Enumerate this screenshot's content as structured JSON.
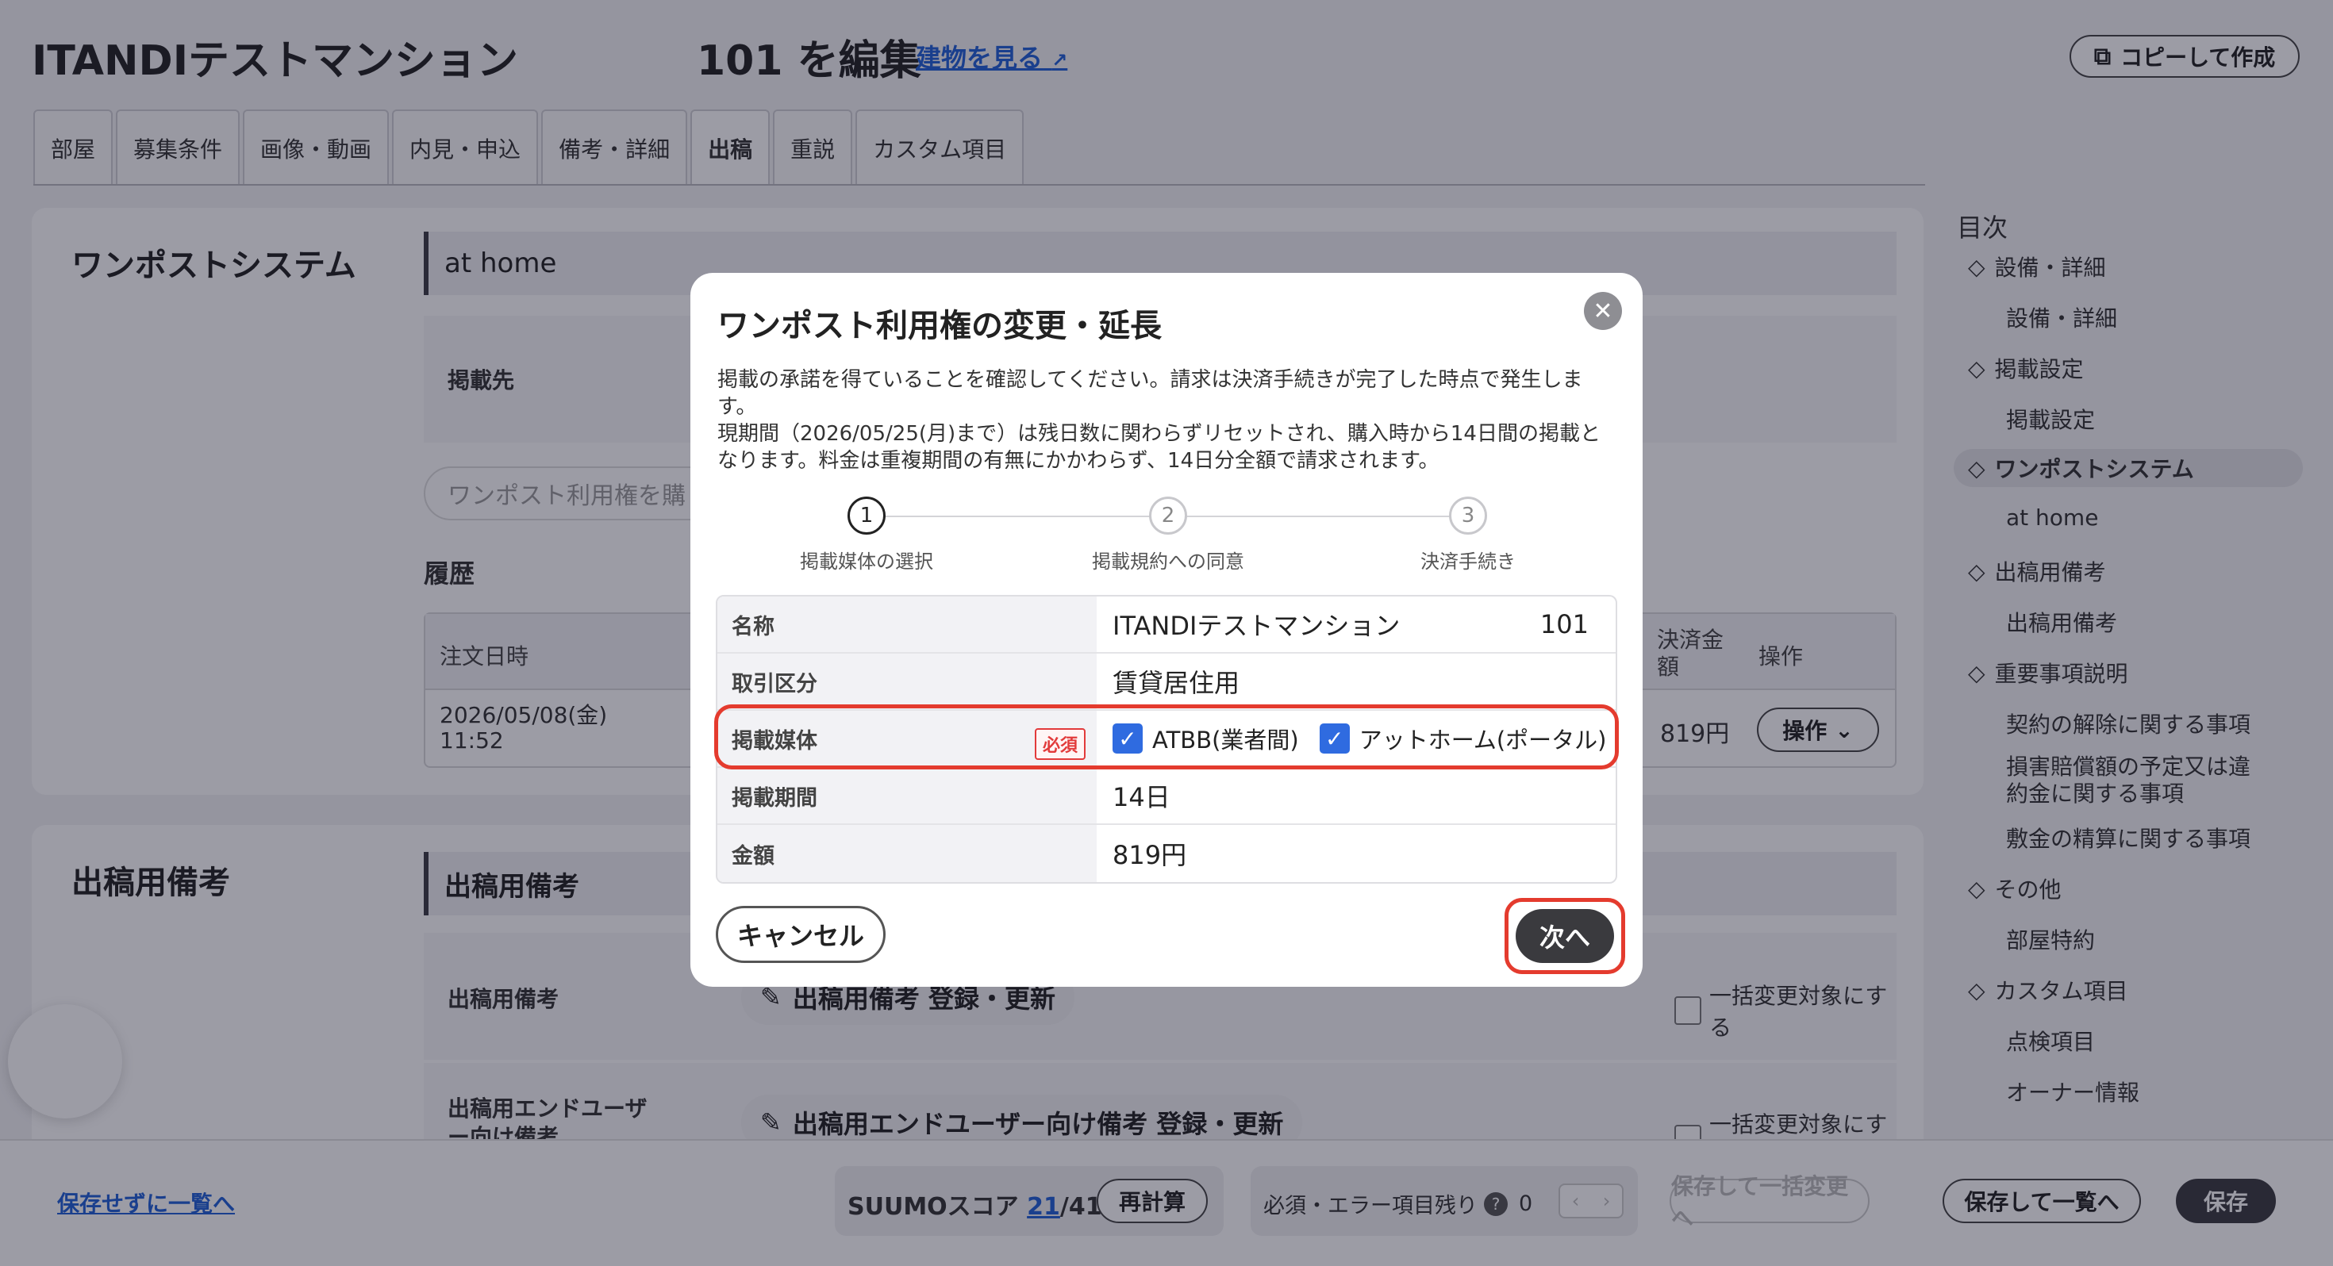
{
  "header": {
    "app_title": "ITANDIテストマンション",
    "edit_title": "101 を編集",
    "building_link": "建物を見る",
    "copy_button": "コピーして作成"
  },
  "tabs": [
    {
      "label": "部屋"
    },
    {
      "label": "募集条件"
    },
    {
      "label": "画像・動画"
    },
    {
      "label": "内見・申込"
    },
    {
      "label": "備考・詳細"
    },
    {
      "label": "出稿",
      "active": true
    },
    {
      "label": "重説"
    },
    {
      "label": "カスタム項目"
    }
  ],
  "onepost": {
    "section_title": "ワンポストシステム",
    "subhead": "at home",
    "destination_label": "掲載先",
    "right_button": "ワンポスト利用権を購",
    "history_label": "履歴",
    "table_headers": {
      "order_date": "注文日時",
      "amount": "決済金額",
      "operation": "操作"
    },
    "row": {
      "date": "2026/05/08(金)",
      "time": "11:52",
      "amount": "819円",
      "operation_button": "操作"
    }
  },
  "remarks": {
    "section_title": "出稿用備考",
    "subhead": "出稿用備考",
    "row1_label": "出稿用備考",
    "row1_button": "出稿用備考 登録・更新",
    "row2_label": "出稿用エンドユーザー向け備考",
    "row2_button": "出稿用エンドユーザー向け備考 登録・更新",
    "bulk_change": "一括変更対象にする"
  },
  "toc": {
    "title": "目次",
    "items": [
      {
        "label": "設備・詳細",
        "type": "group"
      },
      {
        "label": "設備・詳細",
        "type": "sub"
      },
      {
        "label": "掲載設定",
        "type": "group"
      },
      {
        "label": "掲載設定",
        "type": "sub"
      },
      {
        "label": "ワンポストシステム",
        "type": "group",
        "active": true
      },
      {
        "label": "at home",
        "type": "sub"
      },
      {
        "label": "出稿用備考",
        "type": "group"
      },
      {
        "label": "出稿用備考",
        "type": "sub"
      },
      {
        "label": "重要事項説明",
        "type": "group"
      },
      {
        "label": "契約の解除に関する事項",
        "type": "sub"
      },
      {
        "label": "損害賠償額の予定又は違約金に関する事項",
        "type": "sub"
      },
      {
        "label": "敷金の精算に関する事項",
        "type": "sub"
      },
      {
        "label": "その他",
        "type": "group"
      },
      {
        "label": "部屋特約",
        "type": "sub"
      },
      {
        "label": "カスタム項目",
        "type": "group"
      },
      {
        "label": "点検項目",
        "type": "sub"
      },
      {
        "label": "オーナー情報",
        "type": "sub"
      }
    ]
  },
  "bottombar": {
    "back_link": "保存せずに一覧へ",
    "suumo_label": "SUUMOスコア",
    "suumo_score": "21",
    "suumo_total": "/41",
    "recalc_button": "再計算",
    "remaining_label": "必須・エラー項目残り",
    "remaining_count": "0",
    "save_bulk_button": "保存して一括変更へ",
    "save_list_button": "保存して一覧へ",
    "save_button": "保存"
  },
  "modal": {
    "title": "ワンポスト利用権の変更・延長",
    "text_line1": "掲載の承諾を得ていることを確認してください。請求は決済手続きが完了した時点で発生します。",
    "text_line2": "現期間（2026/05/25(月)まで）は残日数に関わらずリセットされ、購入時から14日間の掲載となります。料金は重複期間の有無にかかわらず、14日分全額で請求されます。",
    "steps": [
      {
        "num": "1",
        "label": "掲載媒体の選択"
      },
      {
        "num": "2",
        "label": "掲載規約への同意"
      },
      {
        "num": "3",
        "label": "決済手続き"
      }
    ],
    "rows": {
      "name_label": "名称",
      "name_value": "ITANDIテストマンション",
      "name_room": "101",
      "deal_label": "取引区分",
      "deal_value": "賃貸居住用",
      "media_label": "掲載媒体",
      "required_badge": "必須",
      "media_option1": "ATBB(業者間)",
      "media_option2": "アットホーム(ポータル)",
      "period_label": "掲載期間",
      "period_value": "14日",
      "amount_label": "金額",
      "amount_value": "819円"
    },
    "cancel_button": "キャンセル",
    "next_button": "次へ"
  },
  "colors": {
    "accent_blue": "#2f6be0",
    "link_blue": "#1f5fd6",
    "highlight_red": "#e43b2e",
    "dark_button": "#3a3a3e"
  }
}
